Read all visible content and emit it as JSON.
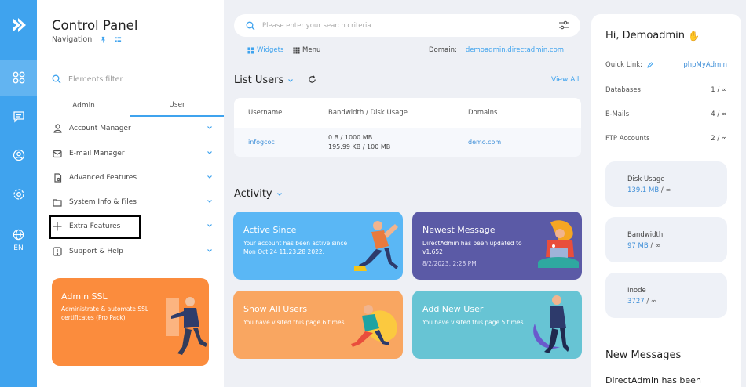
{
  "rail": {
    "language": "EN"
  },
  "nav": {
    "title": "Control Panel",
    "subtitle": "Navigation",
    "filter_placeholder": "Elements filter",
    "tabs": [
      "Admin",
      "User"
    ],
    "items": [
      {
        "label": "Account Manager",
        "icon": "user-icon"
      },
      {
        "label": "E-mail Manager",
        "icon": "mail-icon"
      },
      {
        "label": "Advanced Features",
        "icon": "file-gear-icon"
      },
      {
        "label": "System Info & Files",
        "icon": "folder-icon"
      },
      {
        "label": "Extra Features",
        "icon": "plus-icon"
      },
      {
        "label": "Support & Help",
        "icon": "alert-icon"
      }
    ]
  },
  "promo": {
    "title": "Admin SSL",
    "description": "Administrate & automate SSL certificates (Pro Pack)"
  },
  "search": {
    "placeholder": "Please enter your search criteria"
  },
  "subbar": {
    "widgets": "Widgets",
    "menu": "Menu",
    "domain_label": "Domain:",
    "domain_value": "demoadmin.directadmin.com"
  },
  "list_users": {
    "title": "List Users",
    "view_all": "View All",
    "headers": [
      "Username",
      "Bandwidth / Disk Usage",
      "Domains"
    ],
    "rows": [
      {
        "username": "infogcoc",
        "bandwidth": "0 B  /  1000 MB",
        "disk": "195.99 KB  /  100 MB",
        "domain": "demo.com"
      }
    ]
  },
  "activity": {
    "title": "Activity",
    "cards": [
      {
        "title": "Active Since",
        "text": "Your account has been active since Mon Oct 24 11:23:28 2022.",
        "color": "#5ab7f5"
      },
      {
        "title": "Newest Message",
        "text": "DirectAdmin has been updated to v1.652",
        "date": "8/2/2023, 2:28 PM",
        "color": "#5b5aa6"
      },
      {
        "title": "Show All Users",
        "text": "You have visited this page 6 times",
        "color": "#f9a661"
      },
      {
        "title": "Add New User",
        "text": "You have visited this page 5 times",
        "color": "#67c4d4"
      }
    ]
  },
  "profile": {
    "greeting": "Hi, Demoadmin",
    "quick_link_label": "Quick Link:",
    "quick_link_value": "phpMyAdmin",
    "rows": [
      {
        "label": "Databases",
        "value": "1 / ∞"
      },
      {
        "label": "E-Mails",
        "value": "4 / ∞"
      },
      {
        "label": "FTP Accounts",
        "value": "2 / ∞"
      }
    ],
    "stats": [
      {
        "label": "Disk Usage",
        "used": "139.1 MB",
        "limit": " / ∞"
      },
      {
        "label": "Bandwidth",
        "used": "97 MB",
        "limit": " / ∞"
      },
      {
        "label": "Inode",
        "used": "3727",
        "limit": " / ∞"
      }
    ],
    "new_messages_title": "New Messages",
    "new_messages_preview": "DirectAdmin has been"
  }
}
